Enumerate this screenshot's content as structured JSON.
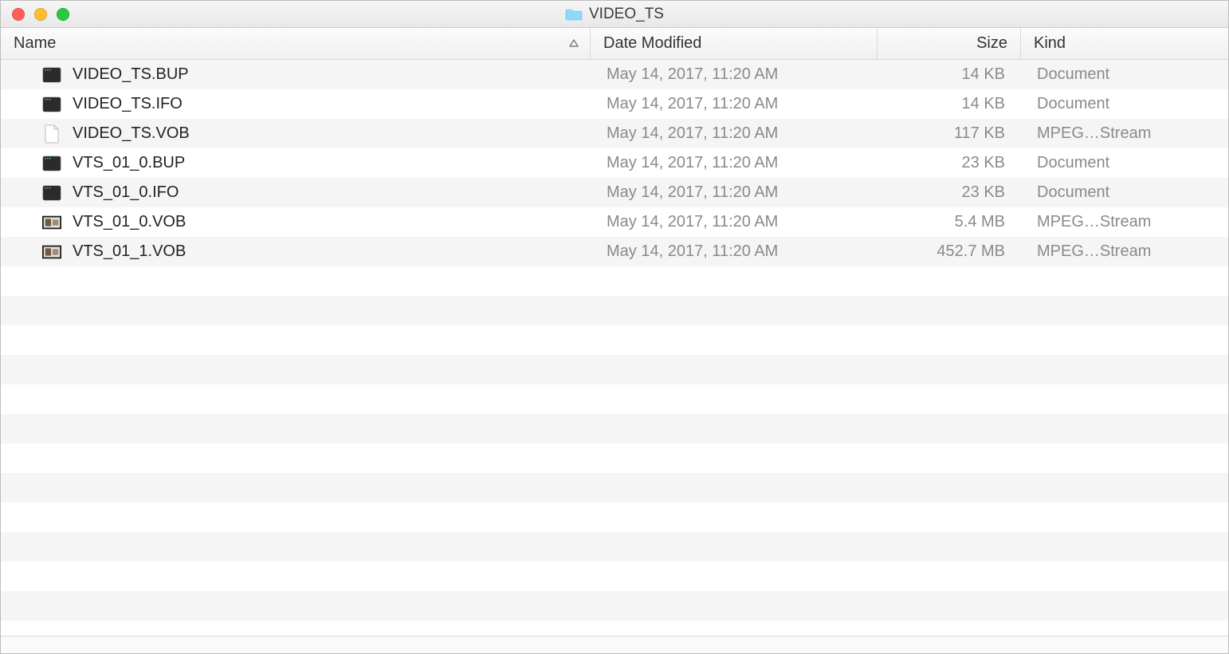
{
  "window": {
    "title": "VIDEO_TS"
  },
  "columns": {
    "name": "Name",
    "date": "Date Modified",
    "size": "Size",
    "kind": "Kind"
  },
  "files": [
    {
      "icon": "terminal",
      "name": "VIDEO_TS.BUP",
      "date": "May 14, 2017, 11:20 AM",
      "size": "14 KB",
      "kind": "Document"
    },
    {
      "icon": "terminal",
      "name": "VIDEO_TS.IFO",
      "date": "May 14, 2017, 11:20 AM",
      "size": "14 KB",
      "kind": "Document"
    },
    {
      "icon": "blank",
      "name": "VIDEO_TS.VOB",
      "date": "May 14, 2017, 11:20 AM",
      "size": "117 KB",
      "kind": "MPEG…Stream"
    },
    {
      "icon": "terminal",
      "name": "VTS_01_0.BUP",
      "date": "May 14, 2017, 11:20 AM",
      "size": "23 KB",
      "kind": "Document"
    },
    {
      "icon": "terminal",
      "name": "VTS_01_0.IFO",
      "date": "May 14, 2017, 11:20 AM",
      "size": "23 KB",
      "kind": "Document"
    },
    {
      "icon": "video",
      "name": "VTS_01_0.VOB",
      "date": "May 14, 2017, 11:20 AM",
      "size": "5.4 MB",
      "kind": "MPEG…Stream"
    },
    {
      "icon": "video",
      "name": "VTS_01_1.VOB",
      "date": "May 14, 2017, 11:20 AM",
      "size": "452.7 MB",
      "kind": "MPEG…Stream"
    }
  ]
}
